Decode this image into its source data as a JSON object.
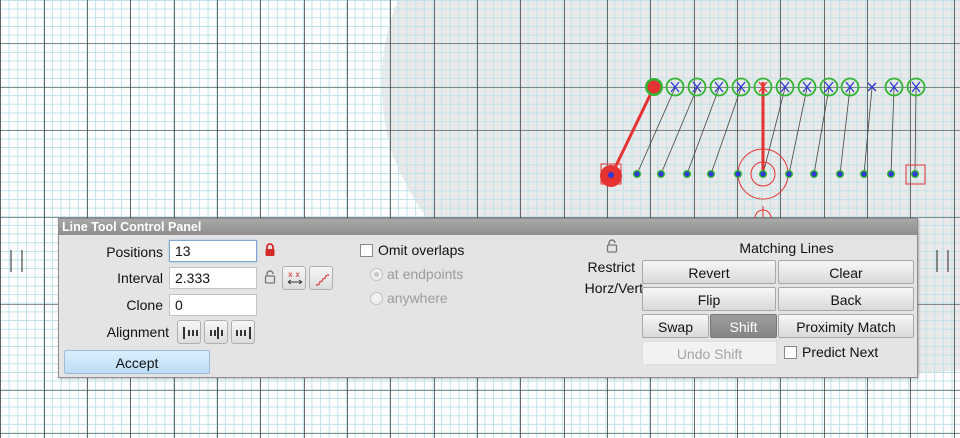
{
  "panel": {
    "title": "Line Tool Control Panel",
    "positions": {
      "label": "Positions",
      "value": "13",
      "locked": true
    },
    "interval": {
      "label": "Interval",
      "value": "2.333",
      "locked": false
    },
    "clone": {
      "label": "Clone",
      "value": "0"
    },
    "alignment": {
      "label": "Alignment"
    },
    "accept_label": "Accept",
    "omit_overlaps": {
      "label": "Omit overlaps",
      "checked": false
    },
    "at_endpoints": {
      "label": "at endpoints",
      "enabled": false
    },
    "anywhere": {
      "label": "anywhere",
      "enabled": false
    },
    "restrict": {
      "line1": "Restrict",
      "line2": "Horz/Vert"
    },
    "matching_lines": {
      "title": "Matching Lines"
    },
    "buttons": {
      "revert": "Revert",
      "clear": "Clear",
      "flip": "Flip",
      "back": "Back",
      "swap": "Swap",
      "shift": "Shift",
      "proximity_match": "Proximity Match",
      "undo_shift": "Undo Shift"
    },
    "predict_next": {
      "label": "Predict Next",
      "checked": false
    }
  },
  "colors": {
    "grid_minor": "#bfe3ea",
    "grid_major": "#3b3b3b",
    "shadow_region": "#e9e9e9",
    "red": "#e53333",
    "green": "#33b533",
    "blue": "#2f38d8",
    "panel_bg": "#e4e4e4"
  }
}
